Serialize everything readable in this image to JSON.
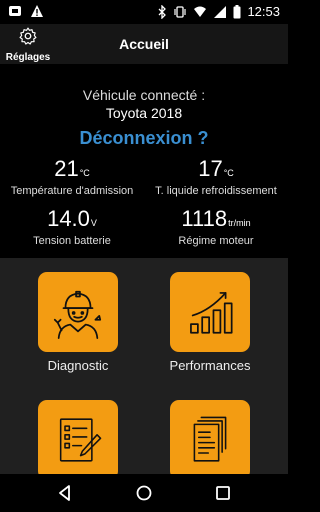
{
  "status": {
    "time": "12:53"
  },
  "appbar": {
    "settings_label": "Réglages",
    "title": "Accueil"
  },
  "vehicle": {
    "heading": "Véhicule connecté :",
    "model": "Toyota 2018"
  },
  "disconnect_label": "Déconnexion ?",
  "metrics": {
    "intake_temp": {
      "value": "21",
      "unit": "°C",
      "label": "Température d'admission"
    },
    "coolant_temp": {
      "value": "17",
      "unit": "°C",
      "label": "T. liquide refroidissement"
    },
    "battery": {
      "value": "14.0",
      "unit": "V",
      "label": "Tension batterie"
    },
    "rpm": {
      "value": "1118",
      "unit": "tr/min",
      "label": "Régime moteur"
    }
  },
  "tiles": [
    {
      "label": "Diagnostic",
      "icon": "mechanic-icon"
    },
    {
      "label": "Performances",
      "icon": "growth-chart-icon"
    },
    {
      "label": "",
      "icon": "checklist-icon"
    },
    {
      "label": "",
      "icon": "documents-icon"
    }
  ],
  "colors": {
    "accent": "#f39c12",
    "link": "#3a8fd1",
    "grid_bg": "#202020"
  }
}
